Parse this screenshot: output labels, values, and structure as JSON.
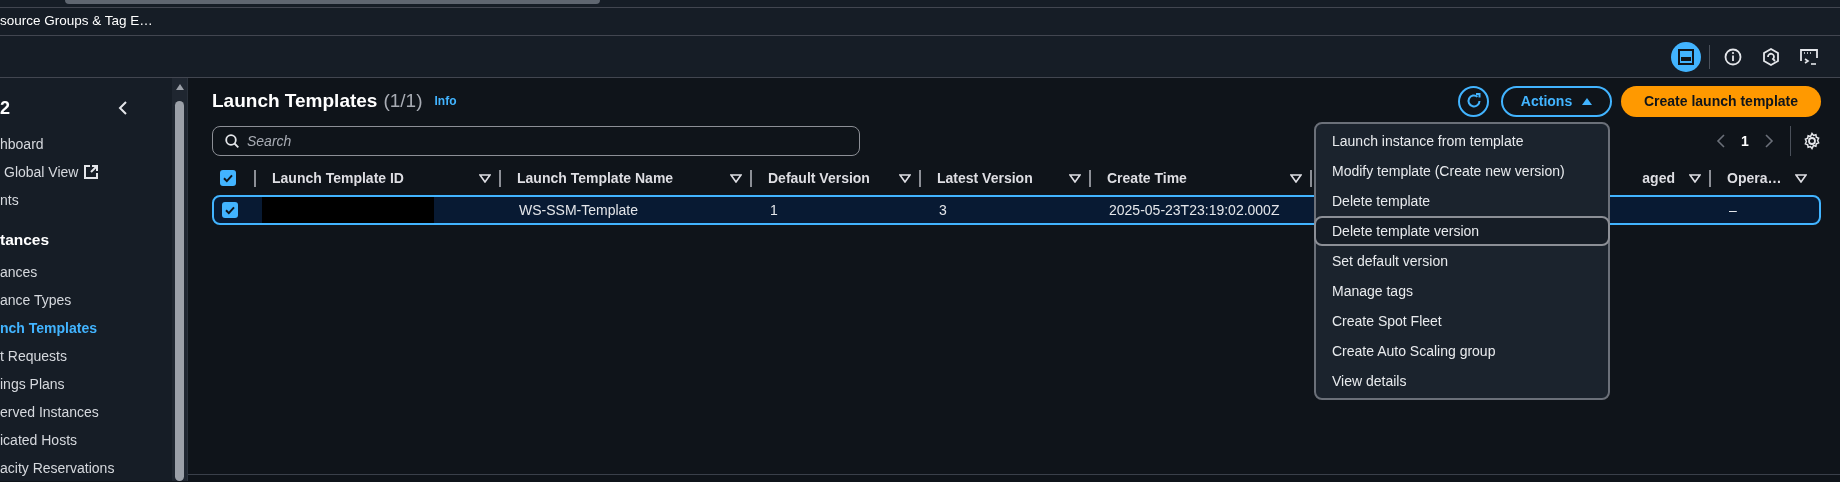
{
  "browser": {
    "tab_title": "source Groups & Tag E…"
  },
  "toolbar": [
    {
      "kind": "panel",
      "selected": true
    },
    {
      "kind": "info",
      "selected": false
    },
    {
      "kind": "hexagon",
      "selected": false
    },
    {
      "kind": "terminal",
      "selected": false
    }
  ],
  "sidebar": {
    "title": "2",
    "items": [
      {
        "label": "hboard",
        "kind": "link",
        "selected": false
      },
      {
        "label": "Global View",
        "kind": "external",
        "selected": false
      },
      {
        "label": "nts",
        "kind": "link",
        "selected": false
      },
      {
        "label": "tances",
        "kind": "heading",
        "selected": false
      },
      {
        "label": "ances",
        "kind": "link",
        "selected": false
      },
      {
        "label": "ance Types",
        "kind": "link",
        "selected": false
      },
      {
        "label": "nch Templates",
        "kind": "link",
        "selected": true
      },
      {
        "label": "t Requests",
        "kind": "link",
        "selected": false
      },
      {
        "label": "ings Plans",
        "kind": "link",
        "selected": false
      },
      {
        "label": "erved Instances",
        "kind": "link",
        "selected": false
      },
      {
        "label": "icated Hosts",
        "kind": "link",
        "selected": false
      },
      {
        "label": "acity Reservations",
        "kind": "link",
        "selected": false
      }
    ]
  },
  "header": {
    "title": "Launch Templates",
    "count": "(1/1)",
    "info": "Info"
  },
  "buttons": {
    "actions": {
      "label": "Actions",
      "expanded": true
    },
    "create": {
      "label": "Create launch template"
    }
  },
  "search": {
    "placeholder": "Search"
  },
  "pagination": {
    "page": "1"
  },
  "table": {
    "all_selected": true,
    "columns": [
      {
        "label": "Launch Template ID",
        "kind": "full"
      },
      {
        "label": "Launch Template Name",
        "kind": "full"
      },
      {
        "label": "Default Version",
        "kind": "full"
      },
      {
        "label": "Latest Version",
        "kind": "full"
      },
      {
        "label": "Create Time",
        "kind": "full"
      },
      {
        "label": "aged",
        "kind": "covered"
      },
      {
        "label": "Opera…",
        "kind": "full"
      }
    ],
    "rows": [
      {
        "selected": true,
        "id_redacted": true,
        "name": "WS-SSM-Template",
        "default_version": "1",
        "latest_version": "3",
        "create_time": "2025-05-23T23:19:02.000Z",
        "operator": "–"
      }
    ]
  },
  "actions_menu": [
    {
      "label": "Launch instance from template",
      "highlighted": false
    },
    {
      "label": "Modify template (Create new version)",
      "highlighted": false
    },
    {
      "label": "Delete template",
      "highlighted": false
    },
    {
      "label": "Delete template version",
      "highlighted": true
    },
    {
      "label": "Set default version",
      "highlighted": false
    },
    {
      "label": "Manage tags",
      "highlighted": false
    },
    {
      "label": "Create Spot Fleet",
      "highlighted": false
    },
    {
      "label": "Create Auto Scaling group",
      "highlighted": false
    },
    {
      "label": "View details",
      "highlighted": false
    }
  ]
}
